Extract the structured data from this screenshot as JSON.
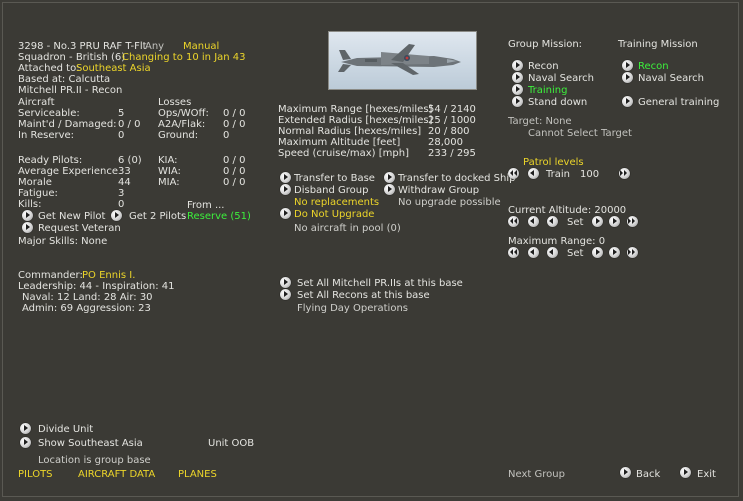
{
  "unit": {
    "title": "3298 - No.3 PRU RAF T-Flt",
    "any": "Any",
    "manual": "Manual",
    "squadron": "Squadron - British (6)",
    "changing": "Changing to 10 in Jan 43",
    "attached_label": "Attached to:",
    "attached_value": "Southeast Asia",
    "based_at": "Based at:  Calcutta",
    "aircraft_type": "Mitchell PR.II - Recon"
  },
  "aircraft": {
    "header": "Aircraft",
    "rows": [
      {
        "label": "Serviceable:",
        "value": "5"
      },
      {
        "label": "Maint'd / Damaged:",
        "value": "0 / 0"
      },
      {
        "label": "In Reserve:",
        "value": "0"
      }
    ]
  },
  "losses": {
    "header": "Losses",
    "rows": [
      {
        "label": "Ops/WOff:",
        "value": "0 / 0"
      },
      {
        "label": "A2A/Flak:",
        "value": "0 / 0"
      },
      {
        "label": "Ground:",
        "value": "0"
      }
    ]
  },
  "pilots": {
    "rows": [
      {
        "label": "Ready Pilots:",
        "value": "6 (0)"
      },
      {
        "label": "Average Experience",
        "value": "33"
      },
      {
        "label": "Morale",
        "value": "44"
      },
      {
        "label": "Fatigue:",
        "value": "3"
      },
      {
        "label": "Kills:",
        "value": "0"
      }
    ],
    "casualties": [
      {
        "label": "KIA:",
        "value": "0 / 0"
      },
      {
        "label": "WIA:",
        "value": "0 / 0"
      },
      {
        "label": "MIA:",
        "value": "0 / 0"
      }
    ],
    "get_new_pilot": "Get New Pilot",
    "get_2_pilots": "Get 2 Pilots",
    "from": "From ...",
    "reserve": "Reserve (51)",
    "request_veteran": "Request Veteran",
    "major_skills": "Major Skills: None"
  },
  "commander": {
    "label": "Commander:",
    "name": "PO Ennis I.",
    "leadership": "Leadership: 44 - Inspiration: 41",
    "naval_land_air": "Naval: 12  Land: 28  Air: 30",
    "admin": "Admin: 69  Aggression: 23"
  },
  "specs": {
    "rows": [
      {
        "label": "Maximum Range [hexes/miles]",
        "value": "54 / 2140"
      },
      {
        "label": "Extended Radius [hexes/miles]",
        "value": "25 / 1000"
      },
      {
        "label": "Normal Radius [hexes/miles]",
        "value": "20 / 800"
      },
      {
        "label": "Maximum Altitude [feet]",
        "value": "28,000"
      },
      {
        "label": "Speed (cruise/max) [mph]",
        "value": "233 / 295"
      }
    ]
  },
  "actions": {
    "transfer_base": "Transfer to Base",
    "transfer_ship": "Transfer to docked Ship",
    "disband": "Disband Group",
    "withdraw": "Withdraw Group",
    "no_replacements": "No replacements",
    "no_upgrade_possible": "No upgrade possible",
    "do_not_upgrade": "Do Not Upgrade",
    "no_aircraft_pool": "No aircraft in pool (0)",
    "set_all_mitchell": "Set All Mitchell PR.IIs at this base",
    "set_all_recons": "Set All Recons at this base",
    "flying_day_ops": "Flying Day Operations"
  },
  "mission": {
    "group_label": "Group Mission:",
    "training_label": "Training Mission",
    "recon": "Recon",
    "naval_search": "Naval Search",
    "training": "Training",
    "stand_down": "Stand down",
    "recon_green": "Recon",
    "naval_search_right": "Naval Search",
    "general_training": "General training",
    "target": "Target: None",
    "cannot_select": "Cannot Select Target",
    "patrol_levels": "Patrol levels",
    "train": "Train",
    "train_value": "100",
    "current_altitude": "Current Altitude: 20000",
    "set": "Set",
    "max_range": "Maximum Range: 0",
    "set2": "Set"
  },
  "bottom": {
    "divide_unit": "Divide Unit",
    "show_region": "Show Southeast Asia",
    "unit_oob": "Unit OOB",
    "location_group_base": "Location is group base",
    "tab_pilots": "PILOTS",
    "tab_aircraft_data": "AIRCRAFT DATA",
    "tab_planes": "PLANES",
    "next_group": "Next Group",
    "back": "Back",
    "exit": "Exit"
  },
  "colors": {
    "background": "#3b3a35",
    "highlight_yellow": "#ecd52a",
    "highlight_green": "#3cf03c"
  }
}
